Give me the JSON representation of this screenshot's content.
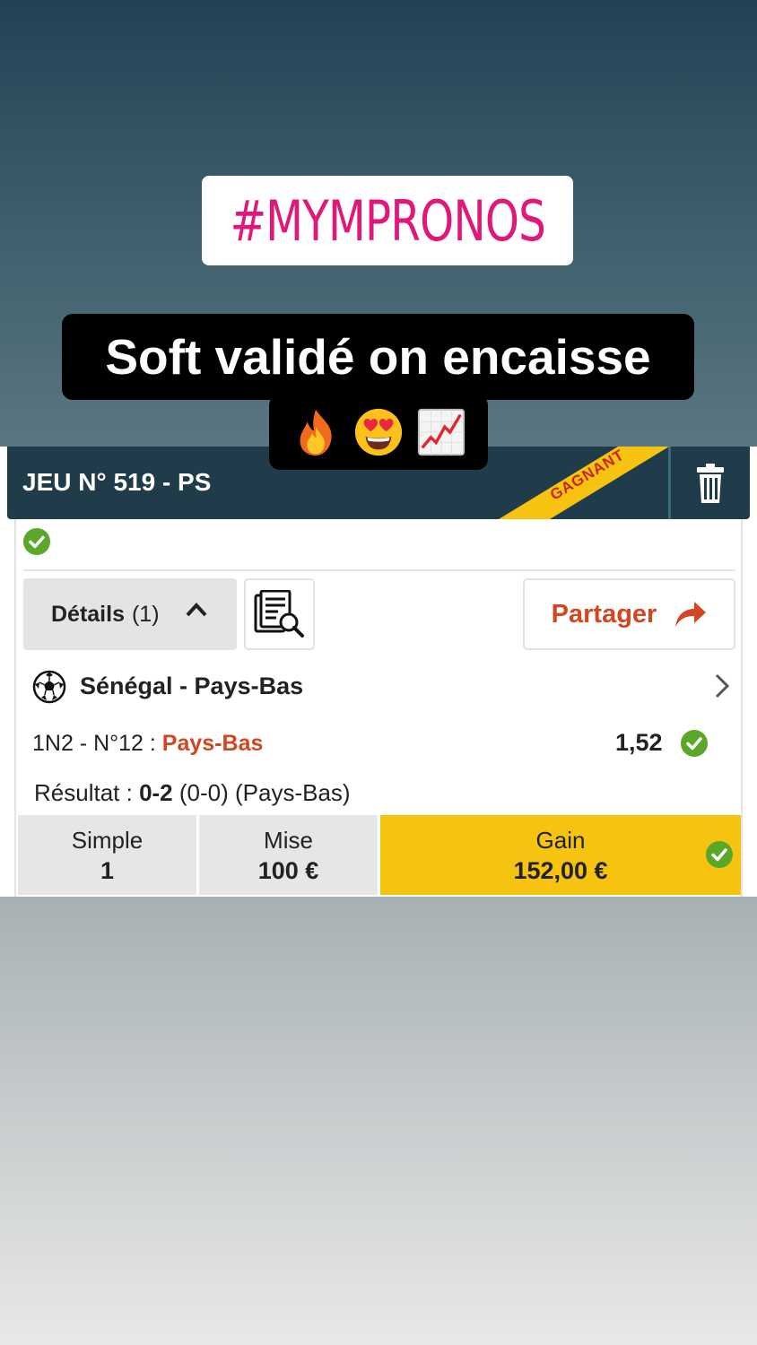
{
  "story": {
    "hashtag": "#MYMPRONOS",
    "caption": "Soft validé on encaisse",
    "emojis": [
      "fire-emoji",
      "heart-eyes-emoji",
      "chart-increasing-emoji"
    ]
  },
  "bet_card": {
    "title": "JEU N° 519 - PS",
    "status_ribbon": "GAGNANT",
    "details_label": "Détails",
    "details_count": "(1)",
    "share_label": "Partager",
    "match": {
      "name": "Sénégal - Pays-Bas",
      "bet_type": "1N2 - N°12 :",
      "selection": "Pays-Bas",
      "odds": "1,52"
    },
    "result": {
      "label": "Résultat :",
      "score": "0-2",
      "halftime": "(0-0)",
      "winner": "(Pays-Bas)"
    },
    "summary": {
      "simple_label": "Simple",
      "simple_value": "1",
      "mise_label": "Mise",
      "mise_value": "100 €",
      "gain_label": "Gain",
      "gain_value": "152,00 €"
    }
  },
  "colors": {
    "hashtag": "#e0187a",
    "header_bg": "#203c4b",
    "ribbon": "#f5c310",
    "accent_orange": "#d24621",
    "win_green": "#5aa72a"
  }
}
